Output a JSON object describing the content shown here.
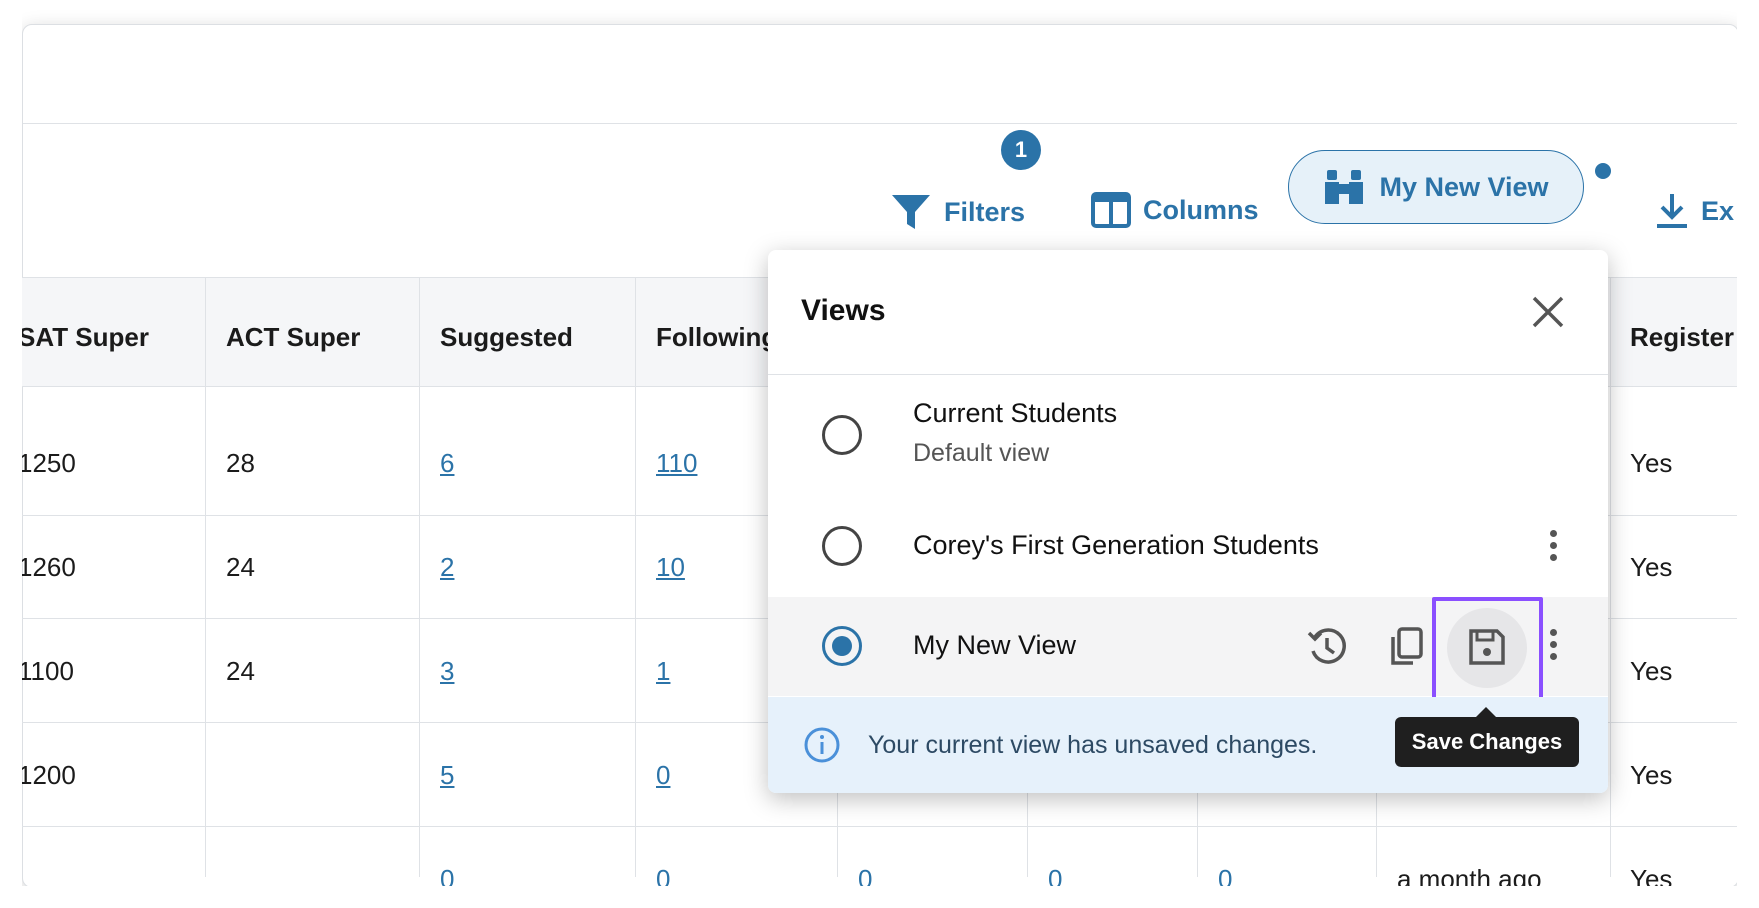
{
  "toolbar": {
    "filters_label": "Filters",
    "filters_badge": "1",
    "columns_label": "Columns",
    "view_label": "My New View",
    "export_label": "Ex"
  },
  "table": {
    "headers": [
      "SAT Super",
      "ACT Super",
      "Suggested",
      "Following",
      "Register"
    ],
    "rows": [
      {
        "sat": "1250",
        "act": "28",
        "suggested": "6",
        "following": "110",
        "registered": "Yes"
      },
      {
        "sat": "1260",
        "act": "24",
        "suggested": "2",
        "following": "10",
        "registered": "Yes"
      },
      {
        "sat": "1100",
        "act": "24",
        "suggested": "3",
        "following": "1",
        "registered": "Yes"
      },
      {
        "sat": "1200",
        "act": "",
        "suggested": "5",
        "following": "0",
        "registered": "Yes"
      },
      {
        "sat": "",
        "act": "",
        "suggested": "0",
        "following": "0",
        "c5": "0",
        "c6": "0",
        "c7": "0",
        "last": "a month ago",
        "registered": "Yes"
      }
    ]
  },
  "views_panel": {
    "title": "Views",
    "items": [
      {
        "name": "Current Students",
        "subtitle": "Default view",
        "selected": false
      },
      {
        "name": "Corey's First Generation Students",
        "selected": false
      },
      {
        "name": "My New View",
        "selected": true
      }
    ],
    "notice": "Your current view has unsaved changes.",
    "tooltip": "Save Changes"
  },
  "colors": {
    "accent": "#2b73a8",
    "highlight": "#8a4fff",
    "notice_bg": "#e6f1fb"
  }
}
